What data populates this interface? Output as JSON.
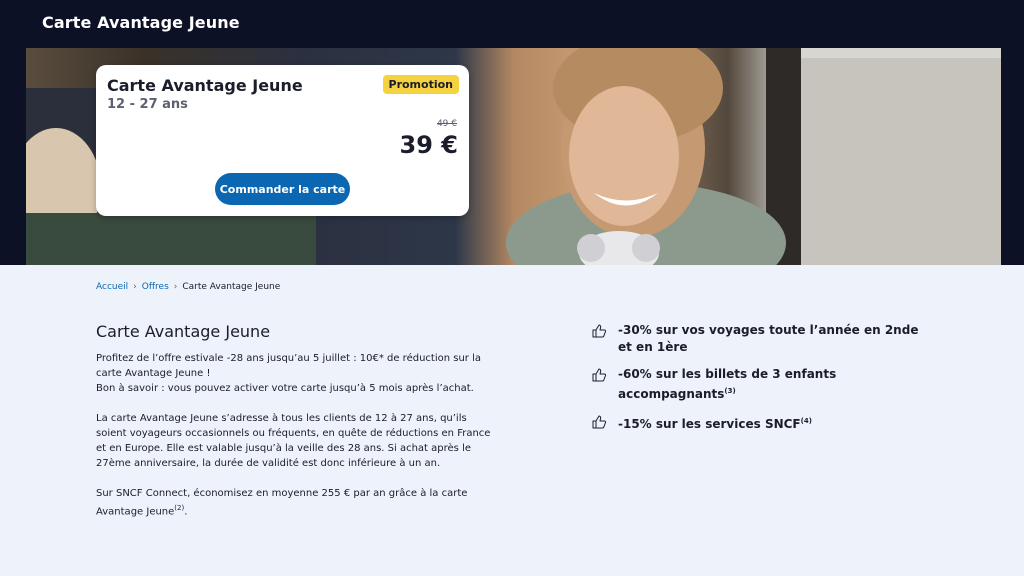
{
  "header": {
    "title": "Carte Avantage Jeune"
  },
  "hero": {
    "card": {
      "title": "Carte Avantage Jeune",
      "subtitle": "12 - 27 ans",
      "badge": "Promotion",
      "old_price": "49 €",
      "price": "39 €",
      "button_label": "Commander la carte"
    },
    "colors": {
      "accent": "#0c67b3",
      "badge": "#f5d23f",
      "dark": "#0d1125"
    }
  },
  "breadcrumb": {
    "items": [
      "Accueil",
      "Offres",
      "Carte Avantage Jeune"
    ],
    "separator": "›"
  },
  "main": {
    "title": "Carte Avantage Jeune",
    "paragraphs": [
      "Profitez de l’offre estivale -28 ans jusqu’au 5 juillet : 10€* de réduction sur la carte Avantage Jeune !",
      "Bon à savoir : vous pouvez activer votre carte jusqu’à 5 mois après l’achat.",
      "La carte Avantage Jeune s’adresse à tous les clients de 12 à 27 ans, qu’ils soient voyageurs occasionnels ou fréquents, en quête de réductions en France et en Europe. Elle est valable jusqu’à la veille des 28 ans. Si achat après le 27ème anniversaire, la durée de validité est donc inférieure à un an.",
      "Sur SNCF Connect, économisez en moyenne 255 € par an grâce à la carte Avantage Jeune",
      "(2)"
    ]
  },
  "benefits": [
    {
      "text": "-30% sur vos voyages toute l’année en 2nde et en 1ère",
      "note": "",
      "icon": "thumbs-up-icon"
    },
    {
      "text": "-60% sur les billets de 3 enfants accompagnants",
      "note": "(3)",
      "icon": "thumbs-up-icon"
    },
    {
      "text": "-15% sur les services SNCF",
      "note": "(4)",
      "icon": "thumbs-up-icon"
    }
  ]
}
